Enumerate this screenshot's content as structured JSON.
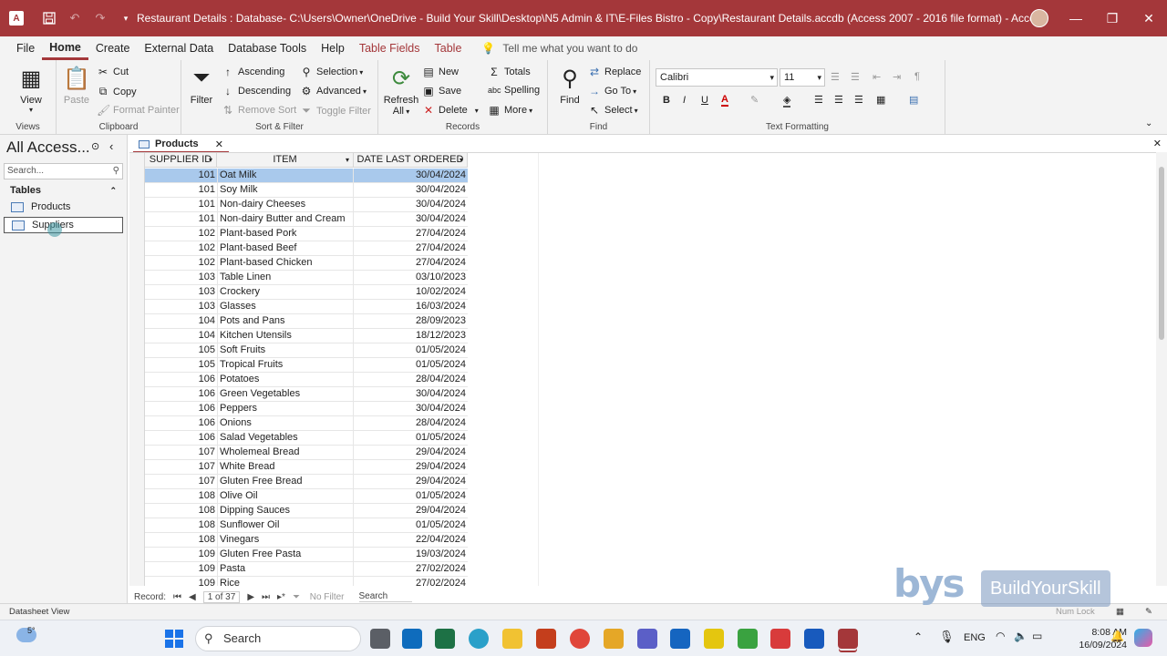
{
  "window": {
    "title": "Restaurant Details : Database- C:\\Users\\Owner\\OneDrive - Build Your Skill\\Desktop\\N5 Admin & IT\\E-Files Bistro - Copy\\Restaurant Details.accdb (Access 2007 - 2016 file format)  -  Access"
  },
  "ribbon_tabs": [
    "File",
    "Home",
    "Create",
    "External Data",
    "Database Tools",
    "Help",
    "Table Fields",
    "Table"
  ],
  "tell_me": "Tell me what you want to do",
  "ribbon": {
    "views": {
      "view": "View",
      "group": "Views"
    },
    "clipboard": {
      "paste": "Paste",
      "cut": "Cut",
      "copy": "Copy",
      "format_painter": "Format Painter",
      "group": "Clipboard"
    },
    "sort_filter": {
      "filter": "Filter",
      "ascending": "Ascending",
      "descending": "Descending",
      "remove_sort": "Remove Sort",
      "selection": "Selection",
      "advanced": "Advanced",
      "toggle_filter": "Toggle Filter",
      "group": "Sort & Filter"
    },
    "records": {
      "refresh": "Refresh",
      "refresh_all": "All",
      "new": "New",
      "save": "Save",
      "delete": "Delete",
      "totals": "Totals",
      "spelling": "Spelling",
      "more": "More",
      "group": "Records"
    },
    "find": {
      "find": "Find",
      "replace": "Replace",
      "goto": "Go To",
      "select": "Select",
      "group": "Find"
    },
    "text_formatting": {
      "font": "Calibri",
      "size": "11",
      "bold": "B",
      "italic": "I",
      "underline": "U",
      "group": "Text Formatting"
    }
  },
  "nav_pane": {
    "title": "All Access...",
    "search_placeholder": "Search...",
    "section": "Tables",
    "items": [
      "Products",
      "Suppliers"
    ]
  },
  "document_tab": "Products",
  "columns": [
    "SUPPLIER ID",
    "ITEM",
    "DATE LAST ORDERED"
  ],
  "rows": [
    [
      "101",
      "Oat Milk",
      "30/04/2024"
    ],
    [
      "101",
      "Soy Milk",
      "30/04/2024"
    ],
    [
      "101",
      "Non-dairy Cheeses",
      "30/04/2024"
    ],
    [
      "101",
      "Non-dairy Butter and Cream",
      "30/04/2024"
    ],
    [
      "102",
      "Plant-based Pork",
      "27/04/2024"
    ],
    [
      "102",
      "Plant-based Beef",
      "27/04/2024"
    ],
    [
      "102",
      "Plant-based Chicken",
      "27/04/2024"
    ],
    [
      "103",
      "Table Linen",
      "03/10/2023"
    ],
    [
      "103",
      "Crockery",
      "10/02/2024"
    ],
    [
      "103",
      "Glasses",
      "16/03/2024"
    ],
    [
      "104",
      "Pots and Pans",
      "28/09/2023"
    ],
    [
      "104",
      "Kitchen Utensils",
      "18/12/2023"
    ],
    [
      "105",
      "Soft Fruits",
      "01/05/2024"
    ],
    [
      "105",
      "Tropical Fruits",
      "01/05/2024"
    ],
    [
      "106",
      "Potatoes",
      "28/04/2024"
    ],
    [
      "106",
      "Green Vegetables",
      "30/04/2024"
    ],
    [
      "106",
      "Peppers",
      "30/04/2024"
    ],
    [
      "106",
      "Onions",
      "28/04/2024"
    ],
    [
      "106",
      "Salad Vegetables",
      "01/05/2024"
    ],
    [
      "107",
      "Wholemeal Bread",
      "29/04/2024"
    ],
    [
      "107",
      "White Bread",
      "29/04/2024"
    ],
    [
      "107",
      "Gluten Free Bread",
      "29/04/2024"
    ],
    [
      "108",
      "Olive Oil",
      "01/05/2024"
    ],
    [
      "108",
      "Dipping Sauces",
      "29/04/2024"
    ],
    [
      "108",
      "Sunflower Oil",
      "01/05/2024"
    ],
    [
      "108",
      "Vinegars",
      "22/04/2024"
    ],
    [
      "109",
      "Gluten Free Pasta",
      "19/03/2024"
    ],
    [
      "109",
      "Pasta",
      "27/02/2024"
    ],
    [
      "109",
      "Rice",
      "27/02/2024"
    ]
  ],
  "record_nav": {
    "label": "Record:",
    "position": "1 of 37",
    "filter": "No Filter",
    "search": "Search"
  },
  "status_bar": {
    "left": "Datasheet View",
    "num_lock": "Num Lock"
  },
  "taskbar": {
    "search": "Search",
    "lang": "ENG",
    "time": "8:08 AM",
    "date": "16/09/2024",
    "weather": "5°"
  },
  "watermark": {
    "logo": "bys",
    "text": "BuildYourSkill"
  },
  "colors": {
    "accent": "#a4373a",
    "selected_row": "#a9c9ec",
    "ribbon_bg": "#f3f3f3"
  }
}
